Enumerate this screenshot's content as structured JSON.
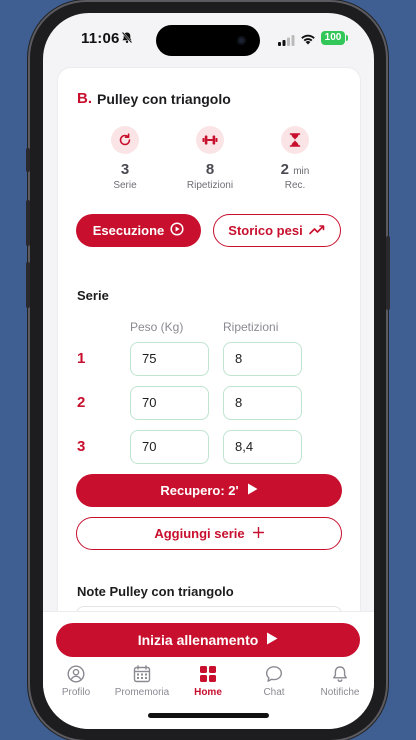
{
  "status_bar": {
    "time": "11:06",
    "battery": "100"
  },
  "exercise": {
    "letter": "B.",
    "title": "Pulley con triangolo",
    "stats": [
      {
        "icon": "refresh-icon",
        "value": "3",
        "unit": "",
        "label": "Serie"
      },
      {
        "icon": "dumbbell-icon",
        "value": "8",
        "unit": "",
        "label": "Ripetizioni"
      },
      {
        "icon": "hourglass-icon",
        "value": "2",
        "unit": "min",
        "label": "Rec."
      }
    ],
    "execution_label": "Esecuzione",
    "history_label": "Storico pesi"
  },
  "sets": {
    "title": "Serie",
    "col_weight": "Peso (Kg)",
    "col_reps": "Ripetizioni",
    "rows": [
      {
        "num": "1",
        "weight": "75",
        "reps": "8"
      },
      {
        "num": "2",
        "weight": "70",
        "reps": "8"
      },
      {
        "num": "3",
        "weight": "70",
        "reps": "8,4"
      }
    ],
    "recovery_label": "Recupero: 2'",
    "add_label": "Aggiungi serie"
  },
  "notes": {
    "title": "Note Pulley con triangolo"
  },
  "start_label": "Inizia allenamento",
  "tabs": [
    {
      "label": "Profilo",
      "icon": "profile-icon",
      "active": false
    },
    {
      "label": "Promemoria",
      "icon": "calendar-icon",
      "active": false
    },
    {
      "label": "Home",
      "icon": "home-grid-icon",
      "active": true
    },
    {
      "label": "Chat",
      "icon": "chat-icon",
      "active": false
    },
    {
      "label": "Notifiche",
      "icon": "bell-icon",
      "active": false
    }
  ],
  "colors": {
    "accent": "#c8102e",
    "input_border": "#bfe5d0",
    "background": "#3f5f93"
  }
}
